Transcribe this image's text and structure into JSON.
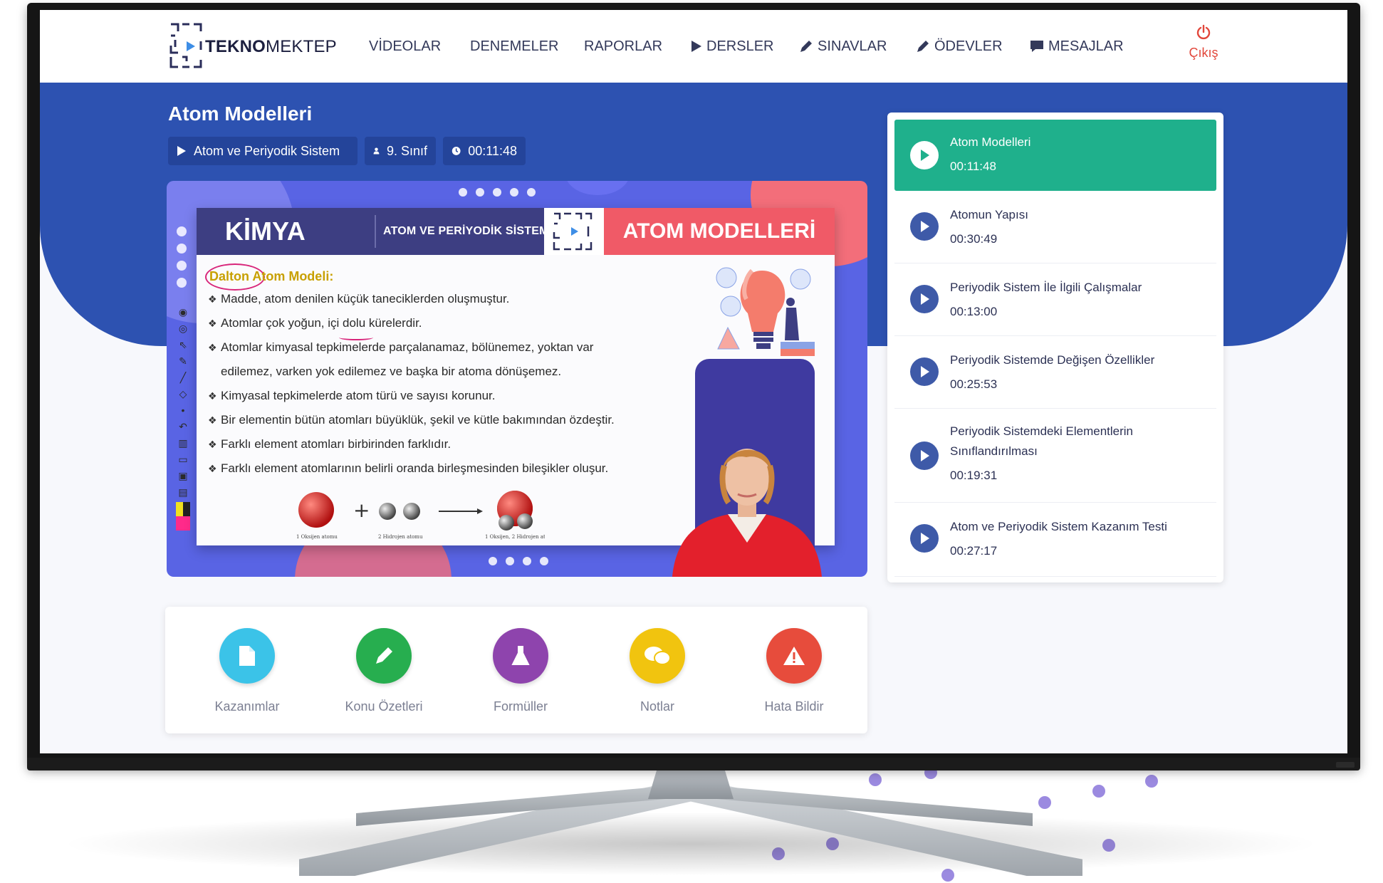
{
  "header": {
    "logo_bold": "TEKNO",
    "logo_rest": "MEKTEP",
    "nav": [
      {
        "label": "VİDEOLAR",
        "icon": ""
      },
      {
        "label": "DENEMELER",
        "icon": ""
      },
      {
        "label": "RAPORLAR",
        "icon": ""
      },
      {
        "label": "DERSLER",
        "icon": "play-icon"
      },
      {
        "label": "SINAVLAR",
        "icon": "pencil-icon"
      },
      {
        "label": "ÖDEVLER",
        "icon": "pencil-icon"
      },
      {
        "label": "MESAJLAR",
        "icon": "chat-icon"
      }
    ],
    "logout_label": "Çıkış",
    "logout_icon": "power-icon"
  },
  "lesson": {
    "title": "Atom Modelleri",
    "unit": "Atom ve Periyodik Sistem",
    "grade": "9. Sınıf",
    "duration": "00:11:48"
  },
  "slide": {
    "subject": "KİMYA",
    "unit": "ATOM VE PERİYODİK SİSTEM",
    "title": "ATOM MODELLERİ",
    "heading": "Dalton Atom Modeli:",
    "bullets": [
      "Madde, atom denilen küçük taneciklerden oluşmuştur.",
      "Atomlar çok yoğun, içi dolu kürelerdir.",
      "Atomlar kimyasal tepkimelerde parçalanamaz, bölünemez, yoktan var",
      "edilemez, varken yok edilemez ve başka bir atoma dönüşemez.",
      "Kimyasal tepkimelerde atom türü ve sayısı korunur.",
      "Bir elementin bütün atomları büyüklük, şekil ve kütle bakımından özdeştir.",
      "Farklı element atomları birbirinden farklıdır.",
      "Farklı element atomlarının belirli oranda birleşmesinden bileşikler oluşur."
    ],
    "diagram_labels": [
      "1 Oksijen atomu",
      "2 Hidrojen atomu",
      "1 Oksijen, 2 Hidrojen atomu"
    ]
  },
  "playlist": [
    {
      "title": "Atom Modelleri",
      "time": "00:11:48",
      "active": true
    },
    {
      "title": "Atomun Yapısı",
      "time": "00:30:49",
      "active": false
    },
    {
      "title": "Periyodik Sistem İle İlgili Çalışmalar",
      "time": "00:13:00",
      "active": false
    },
    {
      "title": "Periyodik Sistemde Değişen Özellikler",
      "time": "00:25:53",
      "active": false
    },
    {
      "title": "Periyodik Sistemdeki Elementlerin Sınıflandırılması",
      "time": "00:19:31",
      "active": false
    },
    {
      "title": "Atom ve Periyodik Sistem Kazanım Testi",
      "time": "00:27:17",
      "active": false
    }
  ],
  "tools": [
    {
      "label": "Kazanımlar",
      "icon": "document-icon",
      "color": "#3bc3e8"
    },
    {
      "label": "Konu Özetleri",
      "icon": "pencil-icon",
      "color": "#27ae4f"
    },
    {
      "label": "Formüller",
      "icon": "flask-icon",
      "color": "#8e44ad"
    },
    {
      "label": "Notlar",
      "icon": "chat-bubbles-icon",
      "color": "#f1c40f"
    },
    {
      "label": "Hata Bildir",
      "icon": "warning-icon",
      "color": "#e74c3c"
    }
  ],
  "colors": {
    "hero": "#2d52b1",
    "active_item": "#1fb08c",
    "logout": "#e2473b",
    "slide_header": "#3d3e82",
    "slide_title_bg": "#f05a67"
  }
}
